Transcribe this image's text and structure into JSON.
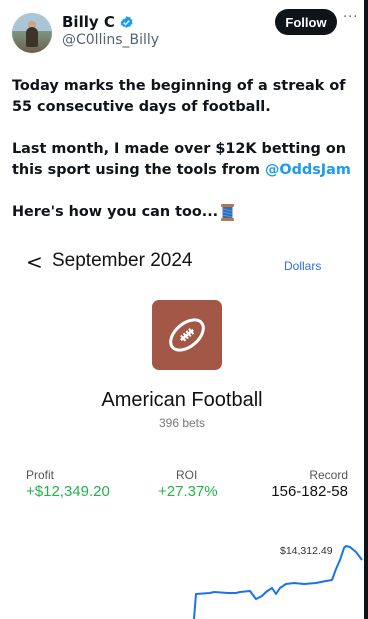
{
  "tweet": {
    "display_name": "Billy C",
    "handle": "@C0llins_Billy",
    "follow_label": "Follow",
    "more_label": "···",
    "line1": "Today marks the beginning of a streak of 55 consecutive days of football.",
    "line2_pre": "Last month, I made over $12K betting on this sport using the tools from ",
    "line2_mention": "@OddsJam",
    "line3": "Here's how you can too...",
    "colors": {
      "accent": "#1d9bf0",
      "text": "#0f1419",
      "secondary": "#536471"
    },
    "icons": {
      "verified": "verified-badge-icon",
      "thread": "spool-of-thread-icon"
    }
  },
  "embed": {
    "back_label": "<",
    "month": "September 2024",
    "currency_toggle": "Dollars",
    "sport": "American Football",
    "bets": "396 bets",
    "stats": [
      {
        "label": "Profit",
        "value": "+$12,349.20"
      },
      {
        "label": "ROI",
        "value": "+27.37%"
      },
      {
        "label": "Record",
        "value": "156-182-58"
      }
    ],
    "balance_label": "$14,312.49",
    "colors": {
      "tile": "#a35746",
      "positive": "#22b24c",
      "line": "#1a73e8"
    }
  }
}
